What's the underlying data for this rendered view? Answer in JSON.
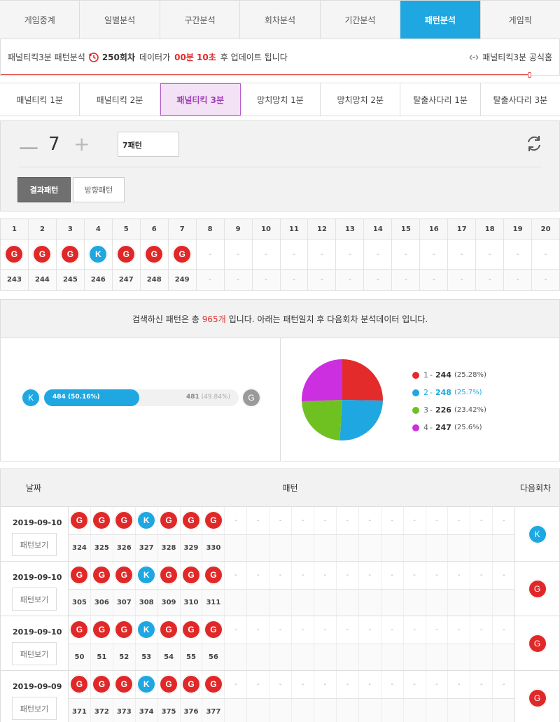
{
  "tabs": [
    "게임중계",
    "일별분석",
    "구간분석",
    "회차분석",
    "기간분석",
    "패턴분석",
    "게임픽"
  ],
  "active_tab": 5,
  "info": {
    "prefix": "패널티킥3분 패턴분석",
    "round": "250회차",
    "mid": "데이터가",
    "time": "00분 10초",
    "suffix": "후 업데이트 됩니다",
    "site_link": "패널티킥3분 공식홈"
  },
  "subtabs": [
    "패널티킥 1분",
    "패널티킥 2분",
    "패널티킥 3분",
    "망치망치 1분",
    "망치망치 2분",
    "탈출사다리 1분",
    "탈출사다리 3분"
  ],
  "active_subtab": 2,
  "control": {
    "minus": "—",
    "value": "7",
    "plus": "+",
    "pattern_input": "7패턴",
    "btn_result": "결과패턴",
    "btn_direction": "방향패턴"
  },
  "grid": {
    "headers": [
      "1",
      "2",
      "3",
      "4",
      "5",
      "6",
      "7",
      "8",
      "9",
      "10",
      "11",
      "12",
      "13",
      "14",
      "15",
      "16",
      "17",
      "18",
      "19",
      "20"
    ],
    "balls": [
      "G",
      "G",
      "G",
      "K",
      "G",
      "G",
      "G",
      "-",
      "-",
      "-",
      "-",
      "-",
      "-",
      "-",
      "-",
      "-",
      "-",
      "-",
      "-",
      "-"
    ],
    "rounds": [
      "243",
      "244",
      "245",
      "246",
      "247",
      "248",
      "249",
      "-",
      "-",
      "-",
      "-",
      "-",
      "-",
      "-",
      "-",
      "-",
      "-",
      "-",
      "-",
      "-"
    ]
  },
  "summary": {
    "pre": "검색하신 패턴은 총",
    "count": "965개",
    "post": "입니다. 아래는 패턴일치 후 다음회차 분석데이터 입니다."
  },
  "stats": {
    "k_label": "K",
    "g_label": "G",
    "k_count": "484",
    "k_pct": "(50.16%)",
    "g_count": "481",
    "g_pct": "(49.84%)",
    "k_fraction": 0.5016
  },
  "chart_data": {
    "type": "pie",
    "categories": [
      "1",
      "2",
      "3",
      "4"
    ],
    "values": [
      244,
      248,
      226,
      247
    ],
    "percent_labels": [
      "(25.28%)",
      "(25.7%)",
      "(23.42%)",
      "(25.6%)"
    ],
    "colors": [
      "#e32b2b",
      "#1ea7e1",
      "#6fc122",
      "#cc2fe0"
    ],
    "highlight": 1
  },
  "results": {
    "head_date": "날짜",
    "head_pattern": "패턴",
    "head_next": "다음회차",
    "view_label": "패턴보기",
    "rows": [
      {
        "date": "2019-09-10",
        "balls": [
          "G",
          "G",
          "G",
          "K",
          "G",
          "G",
          "G"
        ],
        "rounds": [
          "324",
          "325",
          "326",
          "327",
          "328",
          "329",
          "330"
        ],
        "next": "K"
      },
      {
        "date": "2019-09-10",
        "balls": [
          "G",
          "G",
          "G",
          "K",
          "G",
          "G",
          "G"
        ],
        "rounds": [
          "305",
          "306",
          "307",
          "308",
          "309",
          "310",
          "311"
        ],
        "next": "G"
      },
      {
        "date": "2019-09-10",
        "balls": [
          "G",
          "G",
          "G",
          "K",
          "G",
          "G",
          "G"
        ],
        "rounds": [
          "50",
          "51",
          "52",
          "53",
          "54",
          "55",
          "56"
        ],
        "next": "G"
      },
      {
        "date": "2019-09-09",
        "balls": [
          "G",
          "G",
          "G",
          "K",
          "G",
          "G",
          "G"
        ],
        "rounds": [
          "371",
          "372",
          "373",
          "374",
          "375",
          "376",
          "377"
        ],
        "next": "G"
      }
    ]
  }
}
